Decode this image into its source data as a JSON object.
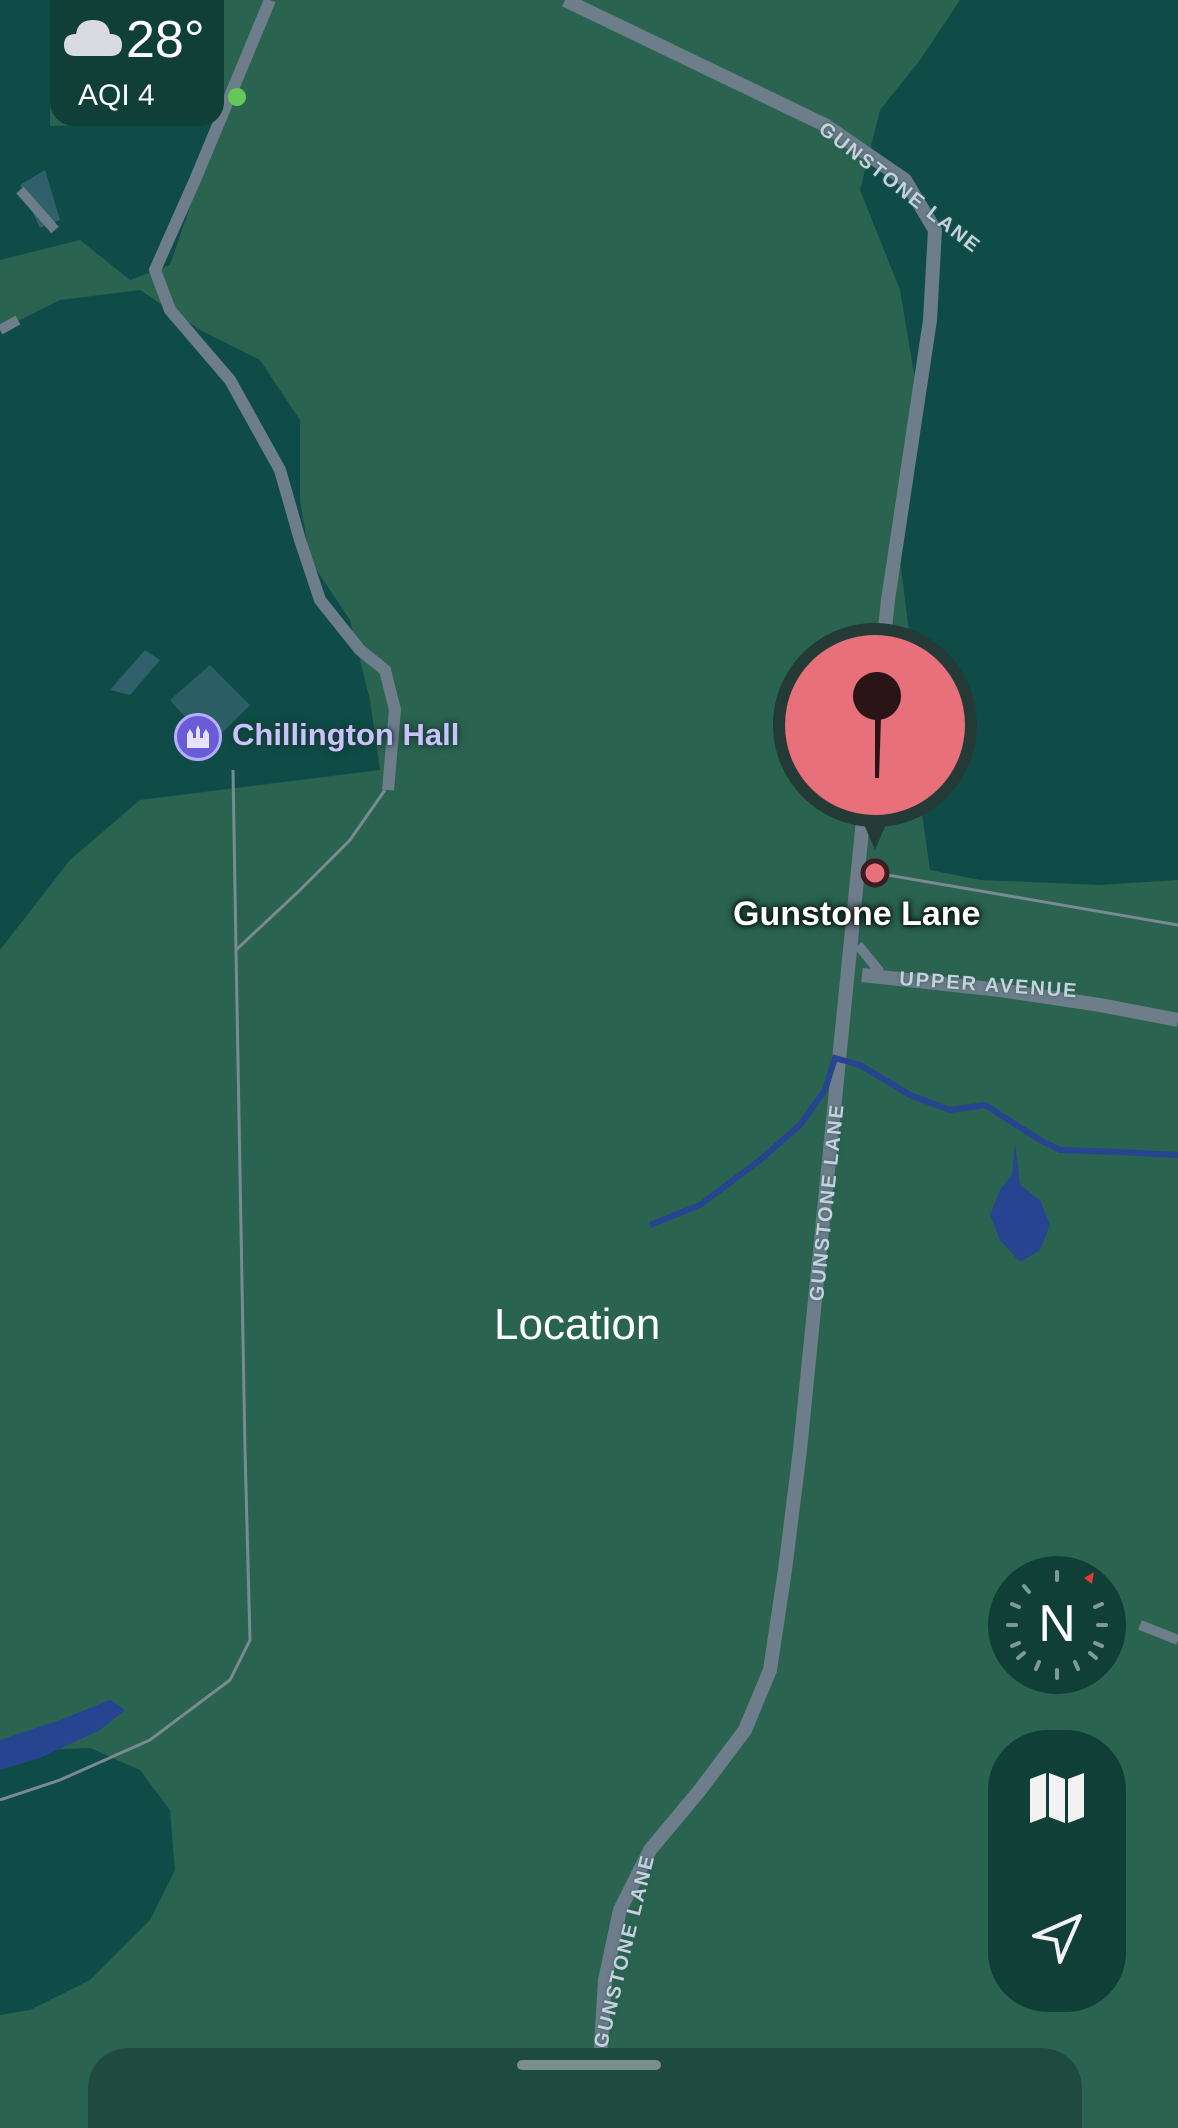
{
  "weather": {
    "temperature": "28°",
    "aqi": "AQI 4",
    "condition_icon": "cloud-icon",
    "aqi_status_color": "#63c75a"
  },
  "poi": {
    "name": "Chillington Hall",
    "icon": "castle-icon"
  },
  "pin": {
    "label": "Gunstone Lane",
    "icon": "pin-icon",
    "color": "#e8707a"
  },
  "map_label": "Location",
  "streets": {
    "gunstone_lane_north": "GUNSTONE LANE",
    "gunstone_lane_middle": "GUNSTONE LANE",
    "gunstone_lane_south": "GUNSTONE LANE",
    "upper_avenue": "UPPER AVENUE"
  },
  "compass": {
    "heading_label": "N"
  },
  "controls": {
    "map_mode_icon": "map-icon",
    "locate_icon": "location-arrow-icon"
  },
  "colors": {
    "land": "#2a6350",
    "water_area": "#0f4c47",
    "river": "#26448f",
    "road": "#6d7d8a"
  }
}
